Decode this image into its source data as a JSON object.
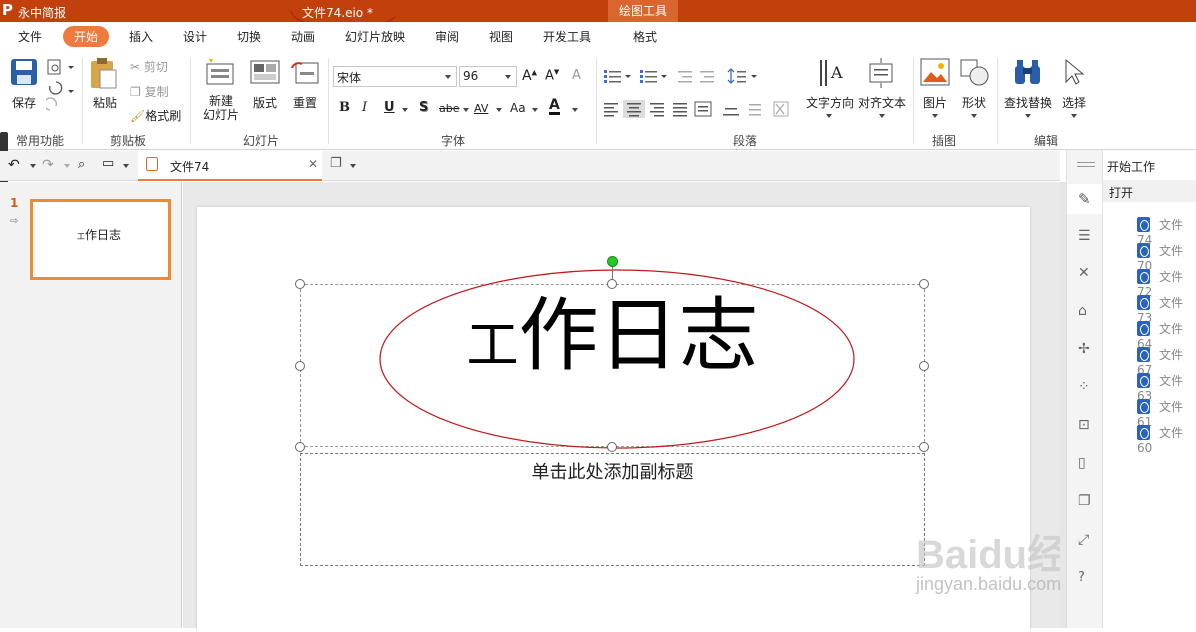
{
  "app": {
    "title": "永中简报",
    "logo": "P",
    "document_title": "文件74.eio *",
    "contextual_tab": "绘图工具"
  },
  "menu": [
    "文件",
    "开始",
    "插入",
    "设计",
    "切换",
    "动画",
    "幻灯片放映",
    "审阅",
    "视图",
    "开发工具",
    "格式"
  ],
  "ribbon": {
    "groups": {
      "common": "常用功能",
      "clipboard": "剪贴板",
      "slides": "幻灯片",
      "font": "字体",
      "paragraph": "段落",
      "illustration": "插图",
      "edit": "编辑"
    },
    "save": "保存",
    "paste": "粘贴",
    "cut": "剪切",
    "copy": "复制",
    "format_painter": "格式刷",
    "new_slide_1": "新建",
    "new_slide_2": "幻灯片",
    "layout": "版式",
    "reset": "重置",
    "font_name": "宋体",
    "font_size": "96",
    "bold": "B",
    "italic": "I",
    "underline": "U",
    "shadow": "S",
    "strike": "abe",
    "spacing": "AV",
    "case": "Aa",
    "font_color": "A",
    "text_direction": "文字方向",
    "align_text": "对齐文本",
    "picture": "图片",
    "shape": "形状",
    "find_replace": "查找替换",
    "select": "选择"
  },
  "tabs": {
    "document_tab": "文件74"
  },
  "thumbnails": [
    {
      "number": "1",
      "small": "工",
      "text": "作日志"
    }
  ],
  "slide": {
    "title_small": "工",
    "title_big": "作日志",
    "subtitle_placeholder": "单击此处添加副标题"
  },
  "taskpane": {
    "header": "开始工作",
    "open": "打开",
    "files": [
      "文件74",
      "文件70",
      "文件72",
      "文件73",
      "文件64",
      "文件67",
      "文件63",
      "文件61",
      "文件60"
    ]
  },
  "watermark": {
    "brand": "Baidu经验",
    "url": "jingyan.baidu.com"
  },
  "colors": {
    "title_bar": "#c1400c",
    "accent": "#ee7a3e",
    "annotation": "#c0191c",
    "rotate_handle": "#22cc22"
  }
}
